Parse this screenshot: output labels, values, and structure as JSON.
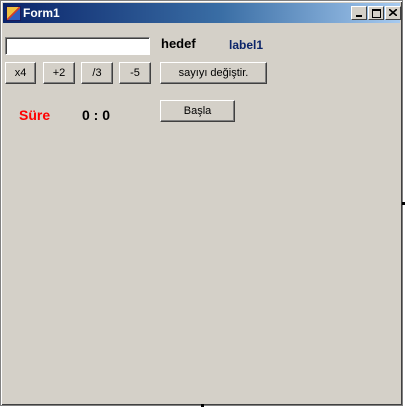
{
  "window": {
    "title": "Form1"
  },
  "form": {
    "input_value": "",
    "hedef_label": "hedef",
    "label1": "label1",
    "buttons": {
      "times4": "x4",
      "plus2": "+2",
      "div3": "/3",
      "minus5": "-5",
      "change_number": "sayıyı değiştir.",
      "start": "Başla"
    },
    "sure_label": "Süre",
    "time_value": "0 : 0"
  },
  "colors": {
    "sure": "#ff0000",
    "label1": "#0a246a",
    "form_background": "#d4d0c8"
  }
}
